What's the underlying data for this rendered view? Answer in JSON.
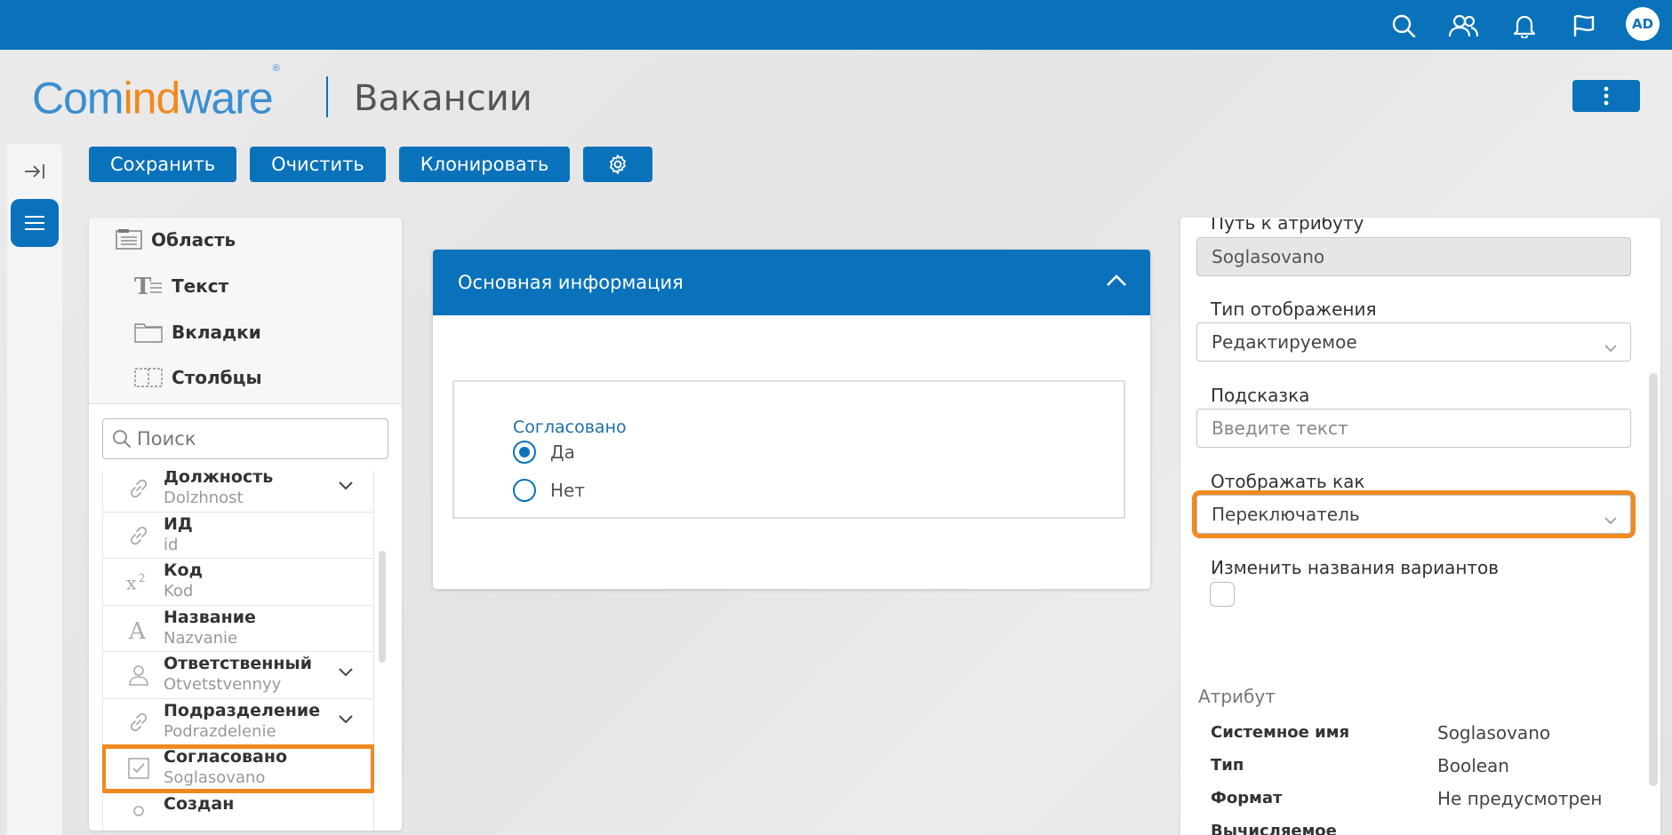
{
  "topbar": {
    "icons": [
      "search-icon",
      "users-icon",
      "bell-icon",
      "flag-icon"
    ],
    "avatar": "AD"
  },
  "brand": {
    "logo_part1": "Com",
    "logo_part2": "ind",
    "logo_part3": "ware",
    "logo_mark": "®"
  },
  "page": {
    "title": "Вакансии"
  },
  "toolbar": {
    "save_label": "Сохранить",
    "clear_label": "Очистить",
    "clone_label": "Клонировать"
  },
  "palette": {
    "elements": [
      {
        "label": "Область",
        "icon": "area-icon"
      },
      {
        "label": "Текст",
        "icon": "text-icon"
      },
      {
        "label": "Вкладки",
        "icon": "tabs-icon"
      },
      {
        "label": "Столбцы",
        "icon": "columns-icon"
      }
    ],
    "search_placeholder": "Поиск",
    "attributes": [
      {
        "name": "Должность",
        "system": "Dolzhnost",
        "icon": "link-icon",
        "expandable": true
      },
      {
        "name": "ИД",
        "system": "id",
        "icon": "link-icon",
        "expandable": false
      },
      {
        "name": "Код",
        "system": "Kod",
        "icon": "number-icon",
        "expandable": false
      },
      {
        "name": "Название",
        "system": "Nazvanie",
        "icon": "text-type-icon",
        "expandable": false
      },
      {
        "name": "Ответственный",
        "system": "Otvetstvennyy",
        "icon": "user-icon",
        "expandable": true
      },
      {
        "name": "Подразделение",
        "system": "Podrazdelenie",
        "icon": "link-icon",
        "expandable": true
      },
      {
        "name": "Согласовано",
        "system": "Soglasovano",
        "icon": "checkbox-icon",
        "expandable": false,
        "highlighted": true
      },
      {
        "name": "Создан",
        "system": "",
        "icon": "user-icon",
        "expandable": false
      }
    ]
  },
  "form": {
    "section_title": "Основная информация",
    "field_label": "Согласовано",
    "options": [
      {
        "label": "Да",
        "selected": true
      },
      {
        "label": "Нет",
        "selected": false
      }
    ]
  },
  "props": {
    "path_label": "Путь к атрибуту",
    "path_value": "Soglasovano",
    "display_type_label": "Тип отображения",
    "display_type_value": "Редактируемое",
    "hint_label": "Подсказка",
    "hint_placeholder": "Введите текст",
    "show_as_label": "Отображать как",
    "show_as_value": "Переключатель",
    "rename_options_label": "Изменить названия вариантов",
    "attribute_section": "Атрибут",
    "kv": [
      {
        "key": "Системное имя",
        "value": "Soglasovano"
      },
      {
        "key": "Тип",
        "value": "Boolean"
      },
      {
        "key": "Формат",
        "value": "Не предусмотрен"
      },
      {
        "key": "Вычисляемое",
        "value": ""
      }
    ]
  },
  "colors": {
    "primary": "#0a72bb",
    "highlight": "#f08a1e"
  }
}
